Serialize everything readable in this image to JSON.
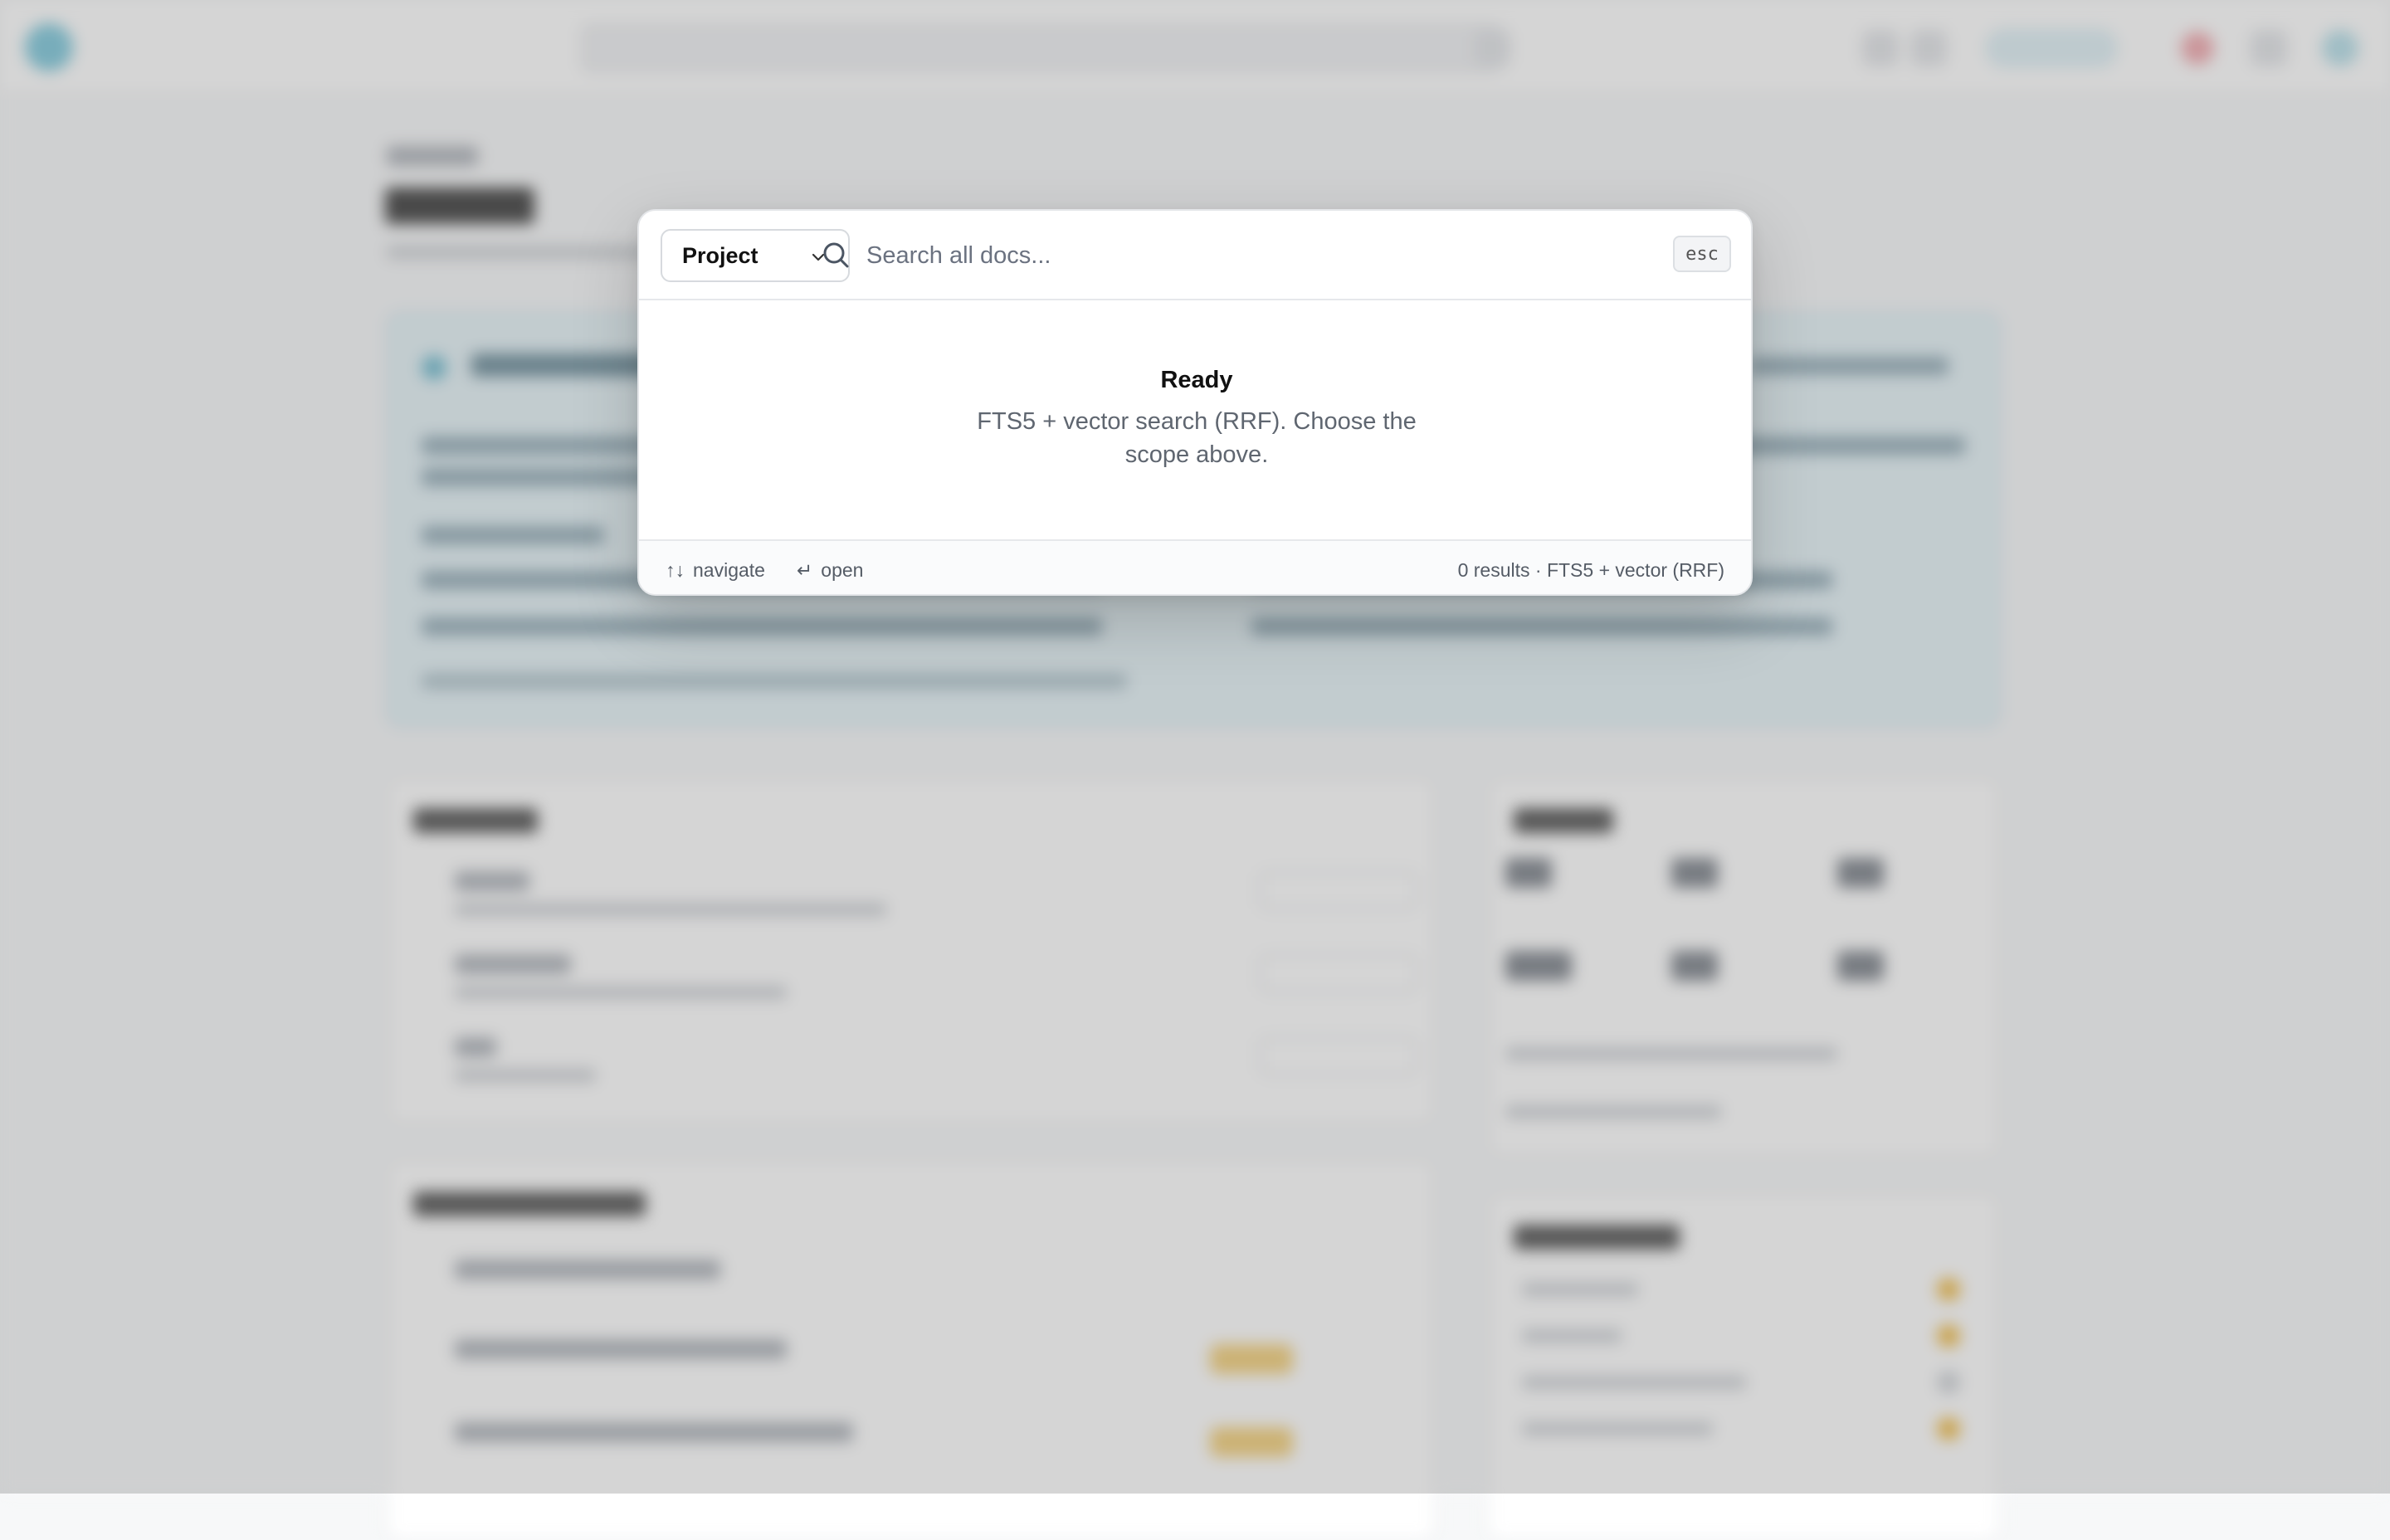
{
  "modal": {
    "scope_selector": {
      "label": "Project",
      "icon": "chevron-down-icon"
    },
    "search": {
      "placeholder": "Search all docs...",
      "value": "",
      "icon": "search-icon"
    },
    "close_key": "esc",
    "status": {
      "title": "Ready",
      "description": "FTS5 + vector search (RRF). Choose the scope above."
    },
    "footer": {
      "navigate_glyph": "↑↓",
      "navigate_label": "navigate",
      "open_glyph": "↵",
      "open_label": "open",
      "result_summary": "0 results · FTS5 + vector (RRF)"
    }
  },
  "colors": {
    "overlay": "#000000",
    "modal_bg": "#ffffff",
    "text_primary": "#111111",
    "text_secondary": "#5f6670",
    "banner_tint": "#e8f4f8"
  }
}
